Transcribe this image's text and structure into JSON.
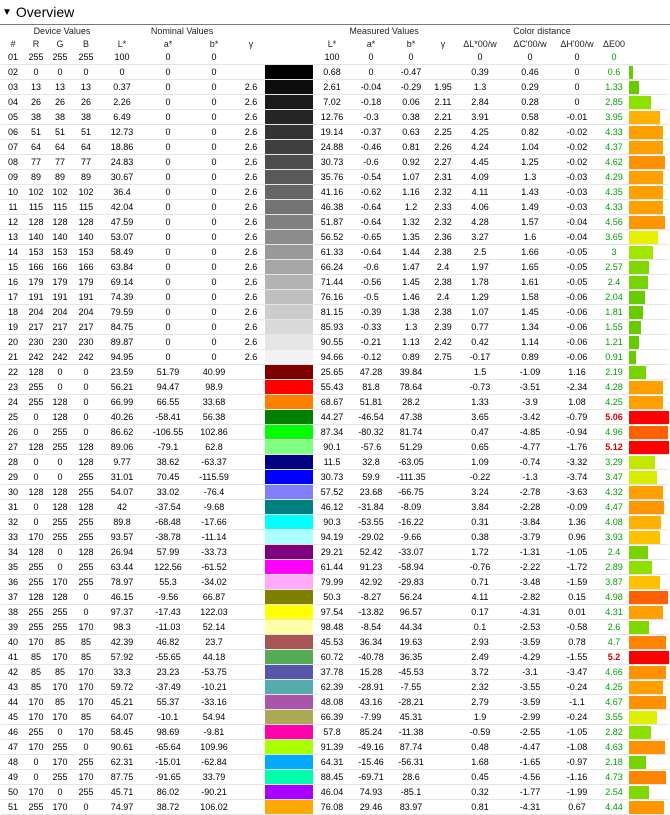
{
  "section_title": "Overview",
  "headers": {
    "group_device": "Device Values",
    "group_nominal": "Nominal Values",
    "group_measured": "Measured Values",
    "group_distance": "Color distance",
    "cols": [
      "#",
      "R",
      "G",
      "B",
      "L*",
      "a*",
      "b*",
      "γ",
      "",
      "L*",
      "a*",
      "b*",
      "γ",
      "ΔL*00/w",
      "ΔC'00/w",
      "ΔH'00/w",
      "ΔE00",
      ""
    ]
  },
  "rows": [
    [
      "01",
      "255",
      "255",
      "255",
      "100",
      "0",
      "0",
      "",
      "#ffffff",
      "100",
      "0",
      "0",
      "",
      "0",
      "0",
      "0",
      "0",
      "#ffffff",
      0
    ],
    [
      "02",
      "0",
      "0",
      "0",
      "0",
      "0",
      "0",
      "",
      "#000000",
      "0.68",
      "0",
      "-0.47",
      "",
      "0.39",
      "0.46",
      "0",
      "0.6",
      "#66cc00",
      0.1
    ],
    [
      "03",
      "13",
      "13",
      "13",
      "0.37",
      "0",
      "0",
      "2.6",
      "#0d0d0d",
      "2.61",
      "-0.04",
      "-0.29",
      "1.95",
      "1.3",
      "0.29",
      "0",
      "1.33",
      "#66cc00",
      0.26
    ],
    [
      "04",
      "26",
      "26",
      "26",
      "2.26",
      "0",
      "0",
      "2.6",
      "#1a1a1a",
      "7.02",
      "-0.18",
      "0.06",
      "2.11",
      "2.84",
      "0.28",
      "0",
      "2.85",
      "#8ee000",
      0.56
    ],
    [
      "05",
      "38",
      "38",
      "38",
      "6.49",
      "0",
      "0",
      "2.6",
      "#262626",
      "12.76",
      "-0.3",
      "0.38",
      "2.21",
      "3.91",
      "0.58",
      "-0.01",
      "3.95",
      "#ffb000",
      0.78
    ],
    [
      "06",
      "51",
      "51",
      "51",
      "12.73",
      "0",
      "0",
      "2.6",
      "#333333",
      "19.14",
      "-0.37",
      "0.63",
      "2.25",
      "4.25",
      "0.82",
      "-0.02",
      "4.33",
      "#ffa000",
      0.85
    ],
    [
      "07",
      "64",
      "64",
      "64",
      "18.86",
      "0",
      "0",
      "2.6",
      "#404040",
      "24.88",
      "-0.46",
      "0.81",
      "2.26",
      "4.24",
      "1.04",
      "-0.02",
      "4.37",
      "#ffa000",
      0.86
    ],
    [
      "08",
      "77",
      "77",
      "77",
      "24.83",
      "0",
      "0",
      "2.6",
      "#4d4d4d",
      "30.73",
      "-0.6",
      "0.92",
      "2.27",
      "4.45",
      "1.25",
      "-0.02",
      "4.62",
      "#ff9000",
      0.91
    ],
    [
      "09",
      "89",
      "89",
      "89",
      "30.67",
      "0",
      "0",
      "2.6",
      "#595959",
      "35.76",
      "-0.54",
      "1.07",
      "2.31",
      "4.09",
      "1.3",
      "-0.03",
      "4.29",
      "#ffa000",
      0.85
    ],
    [
      "10",
      "102",
      "102",
      "102",
      "36.4",
      "0",
      "0",
      "2.6",
      "#666666",
      "41.16",
      "-0.62",
      "1.16",
      "2.32",
      "4.11",
      "1.43",
      "-0.03",
      "4.35",
      "#ffa000",
      0.86
    ],
    [
      "11",
      "115",
      "115",
      "115",
      "42.04",
      "0",
      "0",
      "2.6",
      "#737373",
      "46.38",
      "-0.64",
      "1.2",
      "2.33",
      "4.06",
      "1.49",
      "-0.03",
      "4.33",
      "#ffa000",
      0.85
    ],
    [
      "12",
      "128",
      "128",
      "128",
      "47.59",
      "0",
      "0",
      "2.6",
      "#808080",
      "51.87",
      "-0.64",
      "1.32",
      "2.32",
      "4.28",
      "1.57",
      "-0.04",
      "4.56",
      "#ff9500",
      0.9
    ],
    [
      "13",
      "140",
      "140",
      "140",
      "53.07",
      "0",
      "0",
      "2.6",
      "#8c8c8c",
      "56.52",
      "-0.65",
      "1.35",
      "2.36",
      "3.27",
      "1.6",
      "-0.04",
      "3.65",
      "#e8f000",
      0.72
    ],
    [
      "14",
      "153",
      "153",
      "153",
      "58.49",
      "0",
      "0",
      "2.6",
      "#999999",
      "61.33",
      "-0.64",
      "1.44",
      "2.38",
      "2.5",
      "1.66",
      "-0.05",
      "3",
      "#a0e800",
      0.59
    ],
    [
      "15",
      "166",
      "166",
      "166",
      "63.84",
      "0",
      "0",
      "2.6",
      "#a6a6a6",
      "66.24",
      "-0.6",
      "1.47",
      "2.4",
      "1.97",
      "1.65",
      "-0.05",
      "2.57",
      "#80d800",
      0.51
    ],
    [
      "16",
      "179",
      "179",
      "179",
      "69.14",
      "0",
      "0",
      "2.6",
      "#b3b3b3",
      "71.44",
      "-0.56",
      "1.45",
      "2.38",
      "1.78",
      "1.61",
      "-0.05",
      "2.4",
      "#78d400",
      0.47
    ],
    [
      "17",
      "191",
      "191",
      "191",
      "74.39",
      "0",
      "0",
      "2.6",
      "#bfbfbf",
      "76.16",
      "-0.5",
      "1.46",
      "2.4",
      "1.29",
      "1.58",
      "-0.06",
      "2.04",
      "#66cc00",
      0.4
    ],
    [
      "18",
      "204",
      "204",
      "204",
      "79.59",
      "0",
      "0",
      "2.6",
      "#cccccc",
      "81.15",
      "-0.39",
      "1.38",
      "2.38",
      "1.07",
      "1.45",
      "-0.06",
      "1.81",
      "#66cc00",
      0.36
    ],
    [
      "19",
      "217",
      "217",
      "217",
      "84.75",
      "0",
      "0",
      "2.6",
      "#d9d9d9",
      "85.93",
      "-0.33",
      "1.3",
      "2.39",
      "0.77",
      "1.34",
      "-0.06",
      "1.55",
      "#66cc00",
      0.31
    ],
    [
      "20",
      "230",
      "230",
      "230",
      "89.87",
      "0",
      "0",
      "2.6",
      "#e6e6e6",
      "90.55",
      "-0.21",
      "1.13",
      "2.42",
      "0.42",
      "1.14",
      "-0.06",
      "1.21",
      "#66cc00",
      0.24
    ],
    [
      "21",
      "242",
      "242",
      "242",
      "94.95",
      "0",
      "0",
      "2.6",
      "#f2f2f2",
      "94.66",
      "-0.12",
      "0.89",
      "2.75",
      "-0.17",
      "0.89",
      "-0.06",
      "0.91",
      "#66cc00",
      0.18
    ],
    [
      "22",
      "128",
      "0",
      "0",
      "23.59",
      "51.79",
      "40.99",
      "",
      "#800000",
      "25.65",
      "47.28",
      "39.84",
      "",
      "1.5",
      "-1.09",
      "1.16",
      "2.19",
      "#78d400",
      0.43
    ],
    [
      "23",
      "255",
      "0",
      "0",
      "56.21",
      "94.47",
      "98.9",
      "",
      "#ff0000",
      "55.43",
      "81.8",
      "78.64",
      "",
      "-0.73",
      "-3.51",
      "-2.34",
      "4.28",
      "#ffa000",
      0.85
    ],
    [
      "24",
      "255",
      "128",
      "0",
      "66.99",
      "66.55",
      "33.68",
      "",
      "#ff8000",
      "68.67",
      "51.81",
      "28.2",
      "",
      "1.33",
      "-3.9",
      "1.08",
      "4.25",
      "#ffa000",
      0.84
    ],
    [
      "25",
      "0",
      "128",
      "0",
      "40.26",
      "-58.41",
      "56.38",
      "",
      "#008000",
      "44.27",
      "-46.54",
      "47.38",
      "",
      "3.65",
      "-3.42",
      "-0.79",
      "5.06",
      "#ff0000",
      1.0
    ],
    [
      "26",
      "0",
      "255",
      "0",
      "86.62",
      "-106.55",
      "102.86",
      "",
      "#00ff00",
      "87.34",
      "-80.32",
      "81.74",
      "",
      "0.47",
      "-4.85",
      "-0.94",
      "4.96",
      "#ff6000",
      0.98
    ],
    [
      "27",
      "128",
      "255",
      "128",
      "89.06",
      "-79.1",
      "62.8",
      "",
      "#80ff80",
      "90.1",
      "-57.6",
      "51.29",
      "",
      "0.65",
      "-4.77",
      "-1.76",
      "5.12",
      "#ff0000",
      1.0
    ],
    [
      "28",
      "0",
      "0",
      "128",
      "9.77",
      "38.62",
      "-63.37",
      "",
      "#000080",
      "11.5",
      "32.8",
      "-63.05",
      "",
      "1.09",
      "-0.74",
      "-3.32",
      "3.29",
      "#c0e800",
      0.65
    ],
    [
      "29",
      "0",
      "0",
      "255",
      "31.01",
      "70.45",
      "-115.59",
      "",
      "#0000ff",
      "30.73",
      "59.9",
      "-111.35",
      "",
      "-0.22",
      "-1.3",
      "-3.74",
      "3.47",
      "#d8ec00",
      0.69
    ],
    [
      "30",
      "128",
      "128",
      "255",
      "54.07",
      "33.02",
      "-76.4",
      "",
      "#8080ff",
      "57.52",
      "23.68",
      "-66.75",
      "",
      "3.24",
      "-2.78",
      "-3.63",
      "4.32",
      "#ffa000",
      0.85
    ],
    [
      "31",
      "0",
      "128",
      "128",
      "42",
      "-37.54",
      "-9.68",
      "",
      "#008080",
      "46.12",
      "-31.84",
      "-8.09",
      "",
      "3.84",
      "-2.28",
      "-0.09",
      "4.47",
      "#ff9500",
      0.88
    ],
    [
      "32",
      "0",
      "255",
      "255",
      "89.8",
      "-68.48",
      "-17.66",
      "",
      "#00ffff",
      "90.3",
      "-53.55",
      "-16.22",
      "",
      "0.31",
      "-3.84",
      "1.36",
      "4.08",
      "#ffb000",
      0.81
    ],
    [
      "33",
      "170",
      "255",
      "255",
      "93.57",
      "-38.78",
      "-11.14",
      "",
      "#aaffff",
      "94.19",
      "-29.02",
      "-9.66",
      "",
      "0.38",
      "-3.79",
      "0.96",
      "3.93",
      "#ffc000",
      0.78
    ],
    [
      "34",
      "128",
      "0",
      "128",
      "26.94",
      "57.99",
      "-33.73",
      "",
      "#800080",
      "29.21",
      "52.42",
      "-33.07",
      "",
      "1.72",
      "-1.31",
      "-1.05",
      "2.4",
      "#78d400",
      0.47
    ],
    [
      "35",
      "255",
      "0",
      "255",
      "63.44",
      "122.56",
      "-61.52",
      "",
      "#ff00ff",
      "61.44",
      "91.23",
      "-58.94",
      "",
      "-0.76",
      "-2.22",
      "-1.72",
      "2.89",
      "#8ee000",
      0.57
    ],
    [
      "36",
      "255",
      "170",
      "255",
      "78.97",
      "55.3",
      "-34.02",
      "",
      "#ffaaff",
      "79.99",
      "42.92",
      "-29.83",
      "",
      "0.71",
      "-3.48",
      "-1.59",
      "3.87",
      "#ffc000",
      0.77
    ],
    [
      "37",
      "128",
      "128",
      "0",
      "46.15",
      "-9.56",
      "66.87",
      "",
      "#808000",
      "50.3",
      "-8.27",
      "56.24",
      "",
      "4.11",
      "-2.82",
      "0.15",
      "4.98",
      "#ff6000",
      0.98
    ],
    [
      "38",
      "255",
      "255",
      "0",
      "97.37",
      "-17.43",
      "122.03",
      "",
      "#ffff00",
      "97.54",
      "-13.82",
      "96.57",
      "",
      "0.17",
      "-4.31",
      "0.01",
      "4.31",
      "#ffa000",
      0.85
    ],
    [
      "39",
      "255",
      "255",
      "170",
      "98.3",
      "-11.03",
      "52.14",
      "",
      "#ffffaa",
      "98.48",
      "-8.54",
      "44.34",
      "",
      "0.1",
      "-2.53",
      "-0.58",
      "2.6",
      "#80d800",
      0.51
    ],
    [
      "40",
      "170",
      "85",
      "85",
      "42.39",
      "46.82",
      "23.7",
      "",
      "#aa5555",
      "45.53",
      "36.34",
      "19.63",
      "",
      "2.93",
      "-3.59",
      "0.78",
      "4.7",
      "#ff8500",
      0.93
    ],
    [
      "41",
      "85",
      "170",
      "85",
      "57.92",
      "-55.65",
      "44.18",
      "",
      "#55aa55",
      "60.72",
      "-40.78",
      "36.35",
      "",
      "2.49",
      "-4.29",
      "-1.55",
      "5.2",
      "#ff0000",
      1.0
    ],
    [
      "42",
      "85",
      "85",
      "170",
      "33.3",
      "23.23",
      "-53.75",
      "",
      "#5555aa",
      "37.78",
      "15.28",
      "-45.53",
      "",
      "3.72",
      "-3.1",
      "-3.47",
      "4.66",
      "#ff9000",
      0.92
    ],
    [
      "43",
      "85",
      "170",
      "170",
      "59.72",
      "-37.49",
      "-10.21",
      "",
      "#55aaaa",
      "62.39",
      "-28.91",
      "-7.55",
      "",
      "2.32",
      "-3.55",
      "-0.24",
      "4.25",
      "#ffa000",
      0.84
    ],
    [
      "44",
      "170",
      "85",
      "170",
      "45.21",
      "55.37",
      "-33.16",
      "",
      "#aa55aa",
      "48.08",
      "43.16",
      "-28.21",
      "",
      "2.79",
      "-3.59",
      "-1.1",
      "4.67",
      "#ff9000",
      0.92
    ],
    [
      "45",
      "170",
      "170",
      "85",
      "64.07",
      "-10.1",
      "54.94",
      "",
      "#aaaa55",
      "66.39",
      "-7.99",
      "45.31",
      "",
      "1.9",
      "-2.99",
      "-0.24",
      "3.55",
      "#e0ee00",
      0.7
    ],
    [
      "46",
      "255",
      "0",
      "170",
      "58.45",
      "98.69",
      "-9.81",
      "",
      "#ff00aa",
      "57.8",
      "85.24",
      "-11.38",
      "",
      "-0.59",
      "-2.55",
      "-1.05",
      "2.82",
      "#8ee000",
      0.56
    ],
    [
      "47",
      "170",
      "255",
      "0",
      "90.61",
      "-65.64",
      "109.96",
      "",
      "#aaff00",
      "91.39",
      "-49.16",
      "87.74",
      "",
      "0.48",
      "-4.47",
      "-1.08",
      "4.63",
      "#ff9000",
      0.91
    ],
    [
      "48",
      "0",
      "170",
      "255",
      "62.31",
      "-15.01",
      "-62.84",
      "",
      "#00aaff",
      "64.31",
      "-15.46",
      "-56.31",
      "",
      "1.68",
      "-1.65",
      "-0.97",
      "2.18",
      "#78d400",
      0.43
    ],
    [
      "49",
      "0",
      "255",
      "170",
      "87.75",
      "-91.65",
      "33.79",
      "",
      "#00ffaa",
      "88.45",
      "-69.71",
      "28.6",
      "",
      "0.45",
      "-4.56",
      "-1.16",
      "4.73",
      "#ff8500",
      0.93
    ],
    [
      "50",
      "170",
      "0",
      "255",
      "45.71",
      "86.02",
      "-90.21",
      "",
      "#aa00ff",
      "46.04",
      "74.93",
      "-85.1",
      "",
      "0.32",
      "-1.77",
      "-1.99",
      "2.54",
      "#80d800",
      0.5
    ],
    [
      "51",
      "255",
      "170",
      "0",
      "74.97",
      "38.72",
      "106.02",
      "",
      "#ffaa00",
      "76.08",
      "29.46",
      "83.97",
      "",
      "0.81",
      "-4.31",
      "0.67",
      "4.44",
      "#ff9500",
      0.88
    ]
  ]
}
